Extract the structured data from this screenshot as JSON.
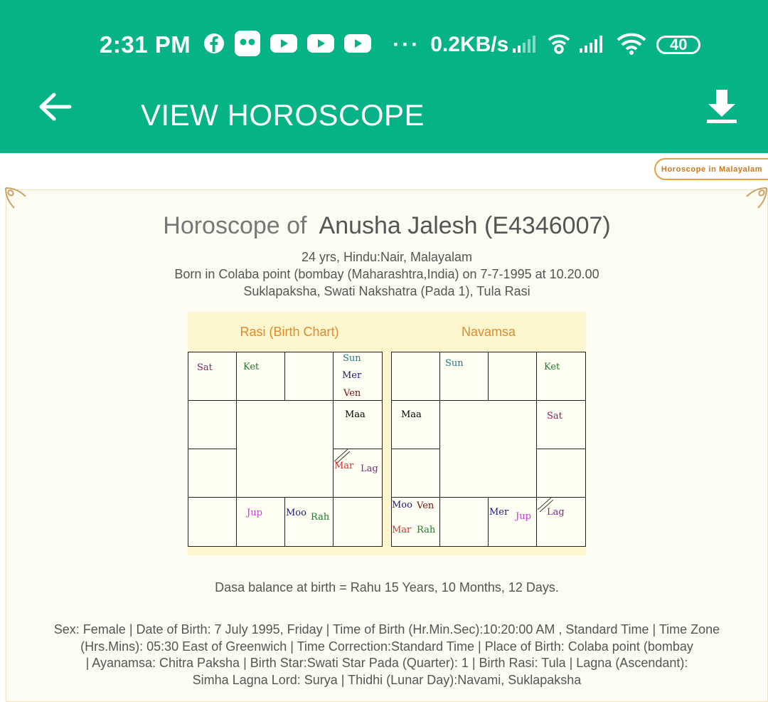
{
  "status_bar": {
    "time": "2:31 PM",
    "icons": [
      "facebook-icon",
      "flickr-icon",
      "youtube-icon",
      "youtube-icon",
      "youtube-icon"
    ],
    "dots": "···",
    "net_speed": "0.2KB/s",
    "battery": "40"
  },
  "app_bar": {
    "title": "VIEW HOROSCOPE",
    "back_icon": "arrow-left-icon",
    "download_icon": "download-icon",
    "bg_color": "#06b386"
  },
  "language_button": "Horoscope in Malayalam",
  "header": {
    "prefix": "Horoscope of",
    "name": "Anusha Jalesh (E4346007)",
    "line1": "24 yrs, Hindu:Nair, Malayalam",
    "line2": "Born in Colaba point (bombay (Maharashtra,India) on 7-7-1995 at 10.20.00",
    "line3": "Suklapaksha, Swati Nakshatra (Pada 1), Tula Rasi"
  },
  "rasi": {
    "title": "Rasi (Birth Chart)",
    "planets": {
      "sat": "Sat",
      "ket": "Ket",
      "sun": "Sun",
      "mer": "Mer",
      "ven": "Ven",
      "maa": "Maa",
      "mar": "Mar",
      "lag": "Lag",
      "jup": "Jup",
      "moo": "Moo",
      "rah": "Rah"
    }
  },
  "navamsa": {
    "title": "Navamsa",
    "planets": {
      "sun": "Sun",
      "ket": "Ket",
      "maa": "Maa",
      "sat": "Sat",
      "moo": "Moo",
      "ven": "Ven",
      "mar": "Mar",
      "rah": "Rah",
      "mer": "Mer",
      "jup": "Jup",
      "lag": "Lag"
    }
  },
  "dasa_balance": "Dasa balance at birth = Rahu 15 Years, 10 Months, 12 Days.",
  "details": {
    "line1": "Sex: Female | Date of Birth: 7 July 1995, Friday | Time of Birth (Hr.Min.Sec):10:20:00 AM , Standard Time | Time Zone",
    "line2": "(Hrs.Mins): 05:30 East of Greenwich | Time Correction:Standard Time | Place of Birth: Colaba point (bombay",
    "line3": "| Ayanamsa: Chitra Paksha | Birth Star:Swati Star Pada (Quarter): 1 | Birth Rasi: Tula | Lagna (Ascendant):",
    "line4": "Simha Lagna Lord: Surya | Thidhi (Lunar Day):Navami, Suklapaksha"
  },
  "colors": {
    "chart_title": "#e08a2a",
    "sat": "#8a1f6a",
    "ket": "#1f7a2a",
    "sun": "#1f7a8a",
    "mer": "#1a1a7a",
    "ven": "#7a0f0f",
    "maa": "#000000",
    "mar": "#d43030",
    "lag": "#7a2a8a",
    "jup": "#c33ad0",
    "moo": "#1a1a7a",
    "rah": "#1f7a2a"
  }
}
